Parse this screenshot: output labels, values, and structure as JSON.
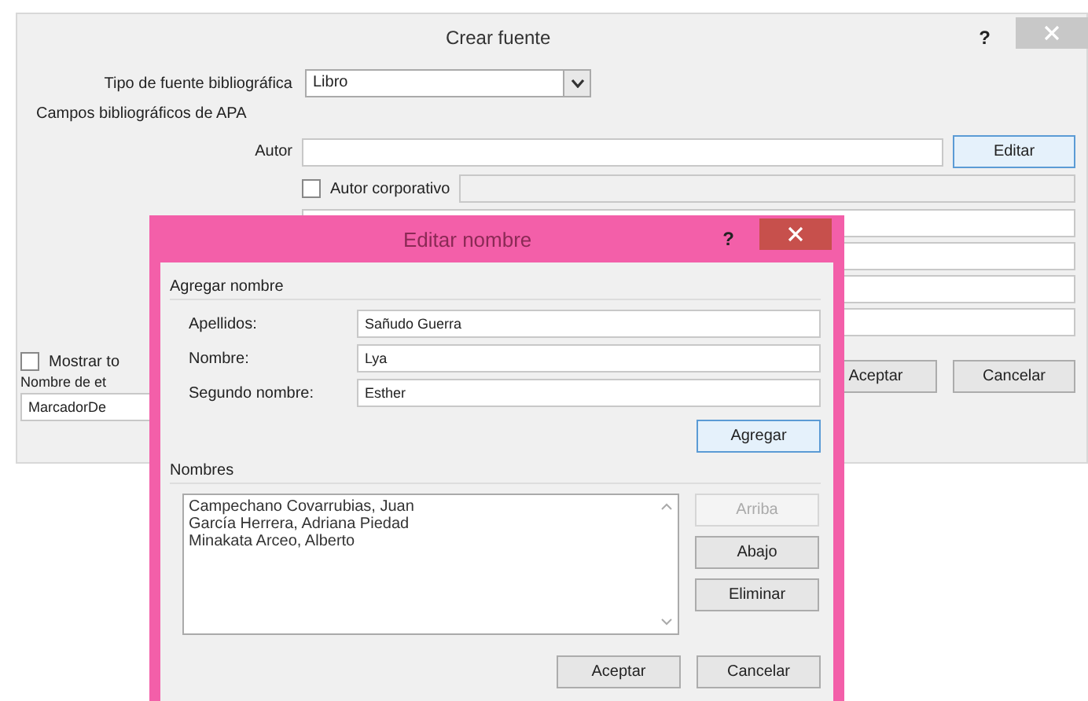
{
  "crear_fuente": {
    "title": "Crear fuente",
    "help": "?",
    "source_type": {
      "label": "Tipo de fuente bibliográfica",
      "value": "Libro"
    },
    "fields_heading": "Campos bibliográficos de APA",
    "author": {
      "label": "Autor",
      "button": "Editar"
    },
    "corporate_author": {
      "label": "Autor corporativo",
      "checked": false
    },
    "show_all": {
      "label": "Mostrar to",
      "checked": false
    },
    "tag_name": {
      "label": "Nombre de et",
      "value": "MarcadorDe"
    },
    "buttons": [
      "Aceptar",
      "Cancelar"
    ]
  },
  "editar_nombre": {
    "title": "Editar nombre",
    "help": "?",
    "group": "Agregar nombre",
    "fields": [
      {
        "label": "Apellidos:",
        "value": "Sañudo Guerra"
      },
      {
        "label": "Nombre:",
        "value": "Lya"
      },
      {
        "label": "Segundo nombre:",
        "value": "Esther"
      }
    ],
    "add_button": "Agregar",
    "list_label": "Nombres",
    "names": [
      {
        "text": "Campechano Covarrubias, Juan",
        "selected": false
      },
      {
        "text": "García Herrera, Adriana Piedad",
        "selected": false
      },
      {
        "text": "Minakata Arceo, Alberto",
        "selected": false
      }
    ],
    "side_buttons": [
      {
        "label": "Arriba",
        "disabled": true
      },
      {
        "label": "Abajo",
        "disabled": false
      },
      {
        "label": "Eliminar",
        "disabled": false
      }
    ],
    "buttons": [
      "Aceptar",
      "Cancelar"
    ]
  }
}
